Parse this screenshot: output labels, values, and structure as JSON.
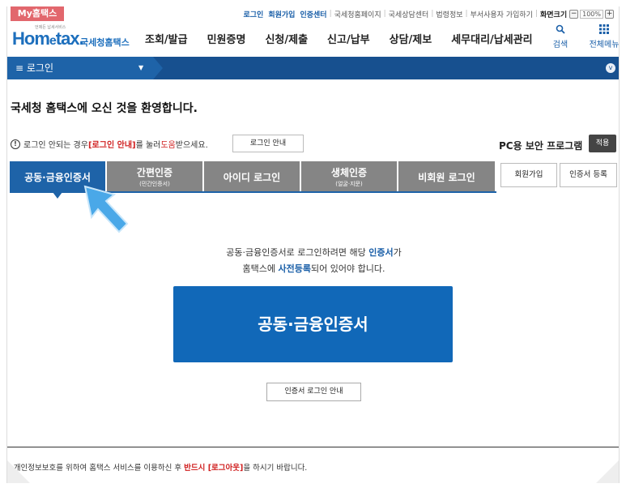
{
  "util": {
    "my_tab": "My홈택스",
    "links": [
      "로그인",
      "회원가입",
      "인증센터",
      "국세청홈페이지",
      "국세상담센터",
      "법령정보",
      "부서사용자 가입하기",
      "화면크기"
    ],
    "zoom_minus": "−",
    "zoom_value": "100%",
    "zoom_plus": "+"
  },
  "header": {
    "logo_small": "언제든 납세서비스",
    "logo_home": "Hom",
    "logo_e": "e",
    "logo_tax": "tax.",
    "logo_kor": "국세청홈택스",
    "menu": [
      "조회/발급",
      "민원증명",
      "신청/제출",
      "신고/납부",
      "상담/제보",
      "세무대리/납세관리"
    ],
    "search_label": "검색",
    "allmenu_label": "전체메뉴"
  },
  "nav": {
    "selected": "≡  로그인",
    "caret": "▼",
    "right_icon": "v"
  },
  "content": {
    "welcome": "국세청 홈택스에 오신 것을 환영합니다.",
    "notice_icon": "!",
    "notice_prefix": "로그인 안되는 경우 ",
    "notice_highlight": "[로그인 안내]",
    "notice_mid": "를 눌러 ",
    "notice_help": "도움",
    "notice_suffix": "받으세요.",
    "login_guide_button": "로그인 안내",
    "pc_security": "PC용 보안 프로그램",
    "apply_button": "적용",
    "tabs": [
      {
        "label": "공동·금융인증서",
        "sub": ""
      },
      {
        "label": "간편인증",
        "sub": "(민간인증서)"
      },
      {
        "label": "아이디 로그인",
        "sub": ""
      },
      {
        "label": "생체인증",
        "sub": "(얼굴·지문)"
      },
      {
        "label": "비회원 로그인",
        "sub": ""
      }
    ],
    "signup_button": "회원가입",
    "cert_register_button": "인증서 등록",
    "desc_line1_a": "공동·금융인증서로 로그인하려면 해당 ",
    "desc_line1_b": "인증서",
    "desc_line1_c": "가",
    "desc_line2_a": "홈택스에 ",
    "desc_line2_b": "사전등록",
    "desc_line2_c": "되어 있어야 합니다.",
    "cert_button": "공동·금융인증서",
    "cert_guide_button": "인증서 로그인 안내"
  },
  "footer": {
    "prefix": "* 개인정보보호를 위하여 홈택스 서비스를 이용하신 후 ",
    "highlight": "반드시 [로그아웃]",
    "suffix": "을 하시기 바랍니다."
  },
  "colors": {
    "primary": "#1e63a8",
    "navbar": "#17508f",
    "tab_inactive": "#858585",
    "my_tab": "#e2676d",
    "alert_red": "#d02020",
    "pointer": "#4aa8e8"
  }
}
